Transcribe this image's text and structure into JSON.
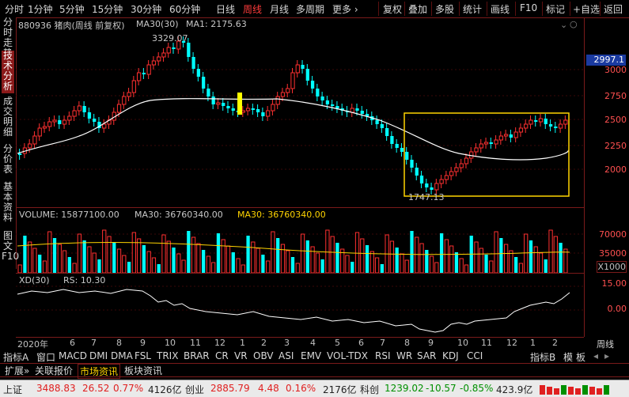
{
  "toolbar": {
    "left_items": [
      "分时",
      "1分钟",
      "5分钟",
      "15分钟",
      "30分钟",
      "60分钟",
      "日线",
      "周线",
      "月线",
      "多周期",
      "更多 ›"
    ],
    "active": "周线",
    "right_items": [
      "复权",
      "叠加",
      "多股",
      "统计",
      "画线",
      "F10",
      "标记",
      "+自选",
      "返回"
    ]
  },
  "left_tabs": [
    "分时走势",
    "技术分析",
    "成交明细",
    "分价表",
    "基本资料",
    "图文F10"
  ],
  "active_left_tab": "技术分析",
  "chart": {
    "title": "880936 猪肉(周线 前复权)",
    "ma30_label": "MA30(30)",
    "ma1_label": "MA1: 2175.63",
    "high_label": "3329.07",
    "low_label": "1747.13",
    "current_price": "2997.1",
    "y_labels": [
      "3000",
      "2750",
      "2500",
      "2250",
      "2000"
    ],
    "colors": {
      "up": "#ff3030",
      "down": "#00ffff",
      "ma": "#ffffff",
      "box": "#ffd400",
      "frame": "#7a1a1a"
    }
  },
  "volume": {
    "label": "VOLUME: 15877100.00",
    "ma30": "MA30: 36760340.00",
    "ma30b": "MA30: 36760340.00",
    "y_labels": [
      "70000",
      "35000"
    ],
    "unit": "X1000"
  },
  "indicator": {
    "label": "XD(30)",
    "rs": "RS: 10.30",
    "y_labels": [
      "15.00",
      "0.00"
    ]
  },
  "dates": [
    "2020年",
    "6",
    "7",
    "8",
    "9",
    "10",
    "11",
    "12",
    "1",
    "2",
    "3",
    "4",
    "5",
    "6",
    "7",
    "8",
    "9",
    "10",
    "11",
    "12",
    "1",
    "2"
  ],
  "date_unit": "周线",
  "bottom_tabs": [
    "指标A",
    "窗口",
    "MACD",
    "DMI",
    "DMA",
    "FSL",
    "TRIX",
    "BRAR",
    "CR",
    "VR",
    "OBV",
    "ASI",
    "EMV",
    "VOL-TDX",
    "RSI",
    "WR",
    "SAR",
    "KDJ",
    "CCI",
    "指标B",
    "模",
    "板"
  ],
  "info_tabs": [
    "扩展»",
    "关联报价",
    "市场资讯",
    "板块资讯"
  ],
  "active_info_tab": "市场资讯",
  "status": {
    "sh_label": "上证",
    "sh_value": "3488.83",
    "sh_change": "26.52",
    "sh_pct": "0.77%",
    "sh_amount": "4126亿",
    "cy_label": "创业",
    "cy_value": "2885.79",
    "cy_change": "4.48",
    "cy_pct": "0.16%",
    "cy_amount": "2176亿",
    "kc_label": "科创",
    "kc_value": "1239.02",
    "kc_change": "-10.57",
    "kc_pct": "-0.85%",
    "kc_amount": "423.9亿"
  }
}
